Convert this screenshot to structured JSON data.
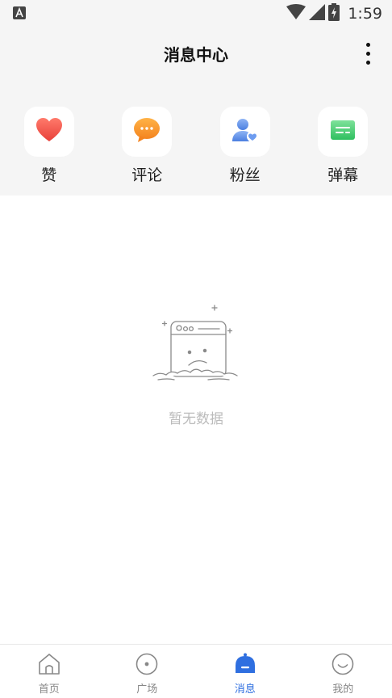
{
  "status_bar": {
    "time": "1:59",
    "app_icon": "a-icon",
    "icons": [
      "wifi-icon",
      "signal-icon",
      "battery-charging-icon"
    ]
  },
  "header": {
    "title": "消息中心",
    "more_icon": "more-vertical-icon"
  },
  "categories": [
    {
      "label": "赞",
      "icon": "heart-icon",
      "color": "#f0524a"
    },
    {
      "label": "评论",
      "icon": "comment-bubble-icon",
      "color": "#f7962a"
    },
    {
      "label": "粉丝",
      "icon": "user-heart-icon",
      "color": "#5b8de8"
    },
    {
      "label": "弹幕",
      "icon": "danmaku-message-icon",
      "color": "#3dc96a"
    }
  ],
  "empty_state": {
    "text": "暂无数据",
    "icon": "empty-browser-sad-icon"
  },
  "bottom_nav": {
    "items": [
      {
        "label": "首页",
        "icon": "home-icon",
        "active": false
      },
      {
        "label": "广场",
        "icon": "square-circle-icon",
        "active": false
      },
      {
        "label": "消息",
        "icon": "bell-icon",
        "active": true
      },
      {
        "label": "我的",
        "icon": "smile-icon",
        "active": false
      }
    ],
    "active_color": "#2f6fe0",
    "inactive_color": "#888888"
  }
}
